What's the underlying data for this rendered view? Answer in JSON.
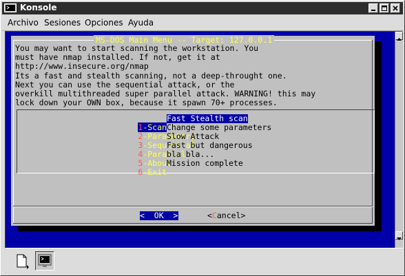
{
  "window": {
    "title": "Konsole"
  },
  "menubar": {
    "items": [
      "Archivo",
      "Sesiones",
      "Opciones",
      "Ayuda"
    ]
  },
  "dialog": {
    "title": "MS-DOS Main Menu -- Target: 127.0.0.1",
    "description": "You may want to start scanning the workstation. You\nmust have nmap installed. If not, get it at\nhttp://www.insecure.org/nmap\nIts a fast and stealth scanning, not a deep-throught one.\nNext you can use the sequential attack, or the\noverkill multithreaded super parallel attack. WARNING! this may\nlock down your OWN box, because it spawn 70+ processes.",
    "options": [
      {
        "num": "1",
        "label": "-Scan",
        "desc": "Fast Stealth scan",
        "selected": true
      },
      {
        "num": "2",
        "label": "-Parameters",
        "desc": "Change some parameters"
      },
      {
        "num": "3",
        "label": "-Sequential",
        "desc": "Slow Attack"
      },
      {
        "num": "4",
        "label": "-Parallel",
        "desc": "Fast but dangerous"
      },
      {
        "num": "5",
        "label": "-About",
        "desc": "bla bla..."
      },
      {
        "num": "6",
        "label": "-Exit",
        "desc": "Mission complete"
      }
    ],
    "ok_button": {
      "left": "<  ",
      "hot": "O",
      "rest": "K  >"
    },
    "cancel_button": {
      "left": "<",
      "hot": "C",
      "rest": "ancel>"
    }
  },
  "colors": {
    "terminal_bg": "#0000a8",
    "dialog_bg": "#c0c0c0",
    "hotkey_red": "#ff5555",
    "label_yellow": "#ffff55",
    "titlebar_bg": "#2d2d2d"
  },
  "toolbar": {
    "icons": [
      "new-session-icon",
      "konsole-terminal-icon"
    ]
  }
}
